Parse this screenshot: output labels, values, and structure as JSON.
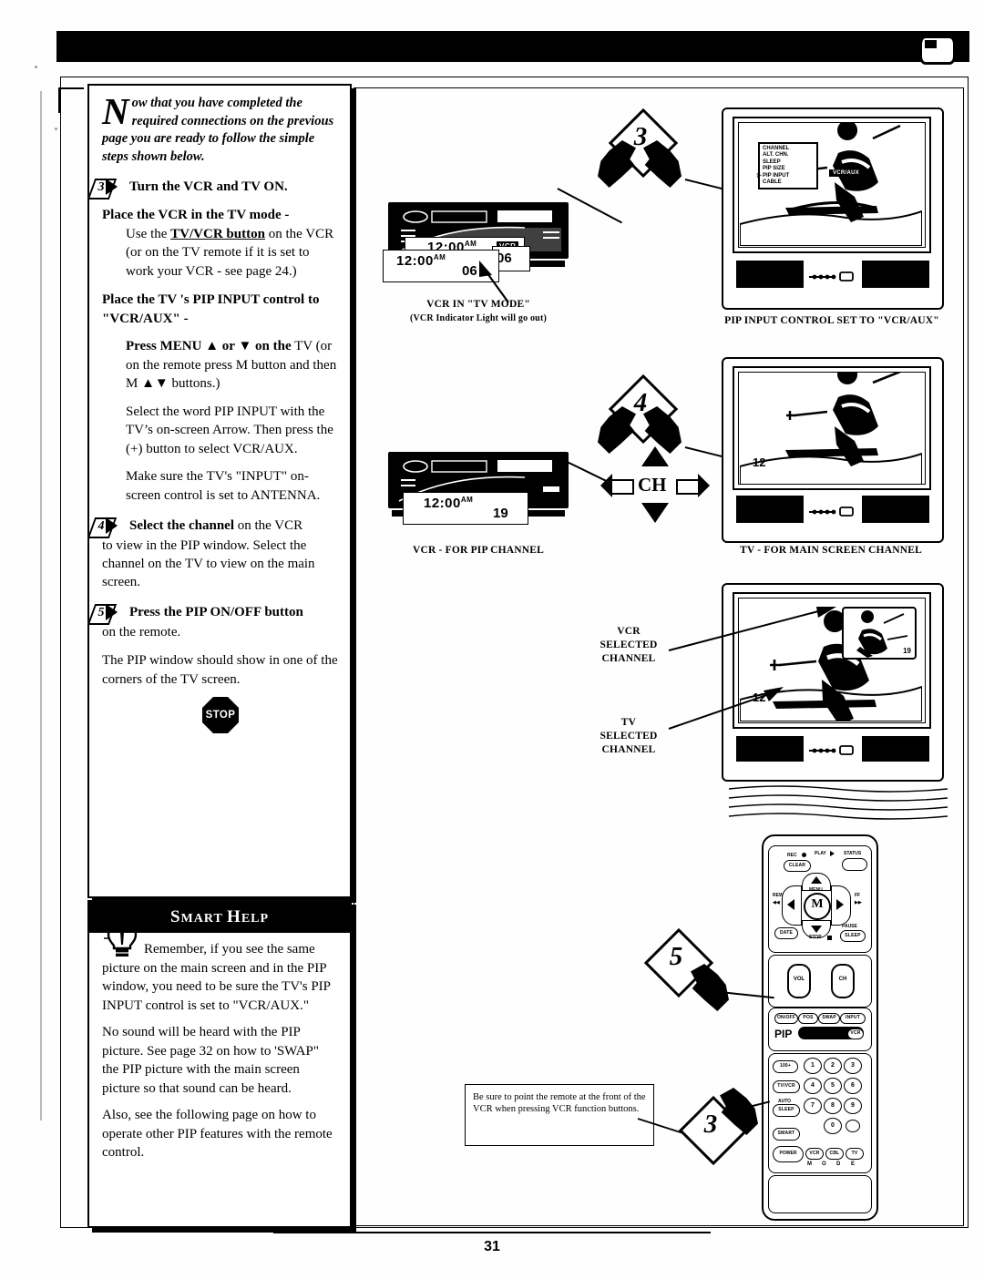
{
  "page": {
    "number": "31",
    "header_icon": "tv-pip-icon"
  },
  "left_column": {
    "intro": {
      "dropcap": "N",
      "text": "ow that you have completed the required connections on the previous page you are ready to follow the simple steps shown below."
    },
    "steps": [
      {
        "number": "3",
        "heading": "Turn the VCR and TV ON.",
        "blocks": [
          {
            "bold": "Place the VCR in the TV mode -",
            "indent": false
          },
          {
            "text_a": "Use the ",
            "underline": "TV/VCR button",
            "text_b": " on the VCR (or on the TV remote if it is set to work your VCR - see page 24.)",
            "indent": true
          },
          {
            "bold": "Place the TV 's PIP INPUT control to \"VCR/AUX\" -",
            "indent": false
          },
          {
            "bold_b": "Press MENU ▲ or ▼ on the",
            "text_b2": " TV (or on the remote press M button and then M ▲▼ buttons.)",
            "indent": true
          },
          {
            "text": "Select the word PIP INPUT with the TV’s on-screen Arrow. Then press the (+) button to select VCR/AUX.",
            "indent": true
          },
          {
            "text": "Make sure the TV's \"INPUT\" on-screen control is set to ANTENNA.",
            "indent": true
          }
        ]
      },
      {
        "number": "4",
        "heading_bold": "Select the channel",
        "heading_rest": " on the VCR",
        "body": "to view in the PIP window. Select the channel on the TV to view on the main screen."
      },
      {
        "number": "5",
        "heading_bold": "Press the PIP ON/OFF button",
        "heading_rest": "",
        "body": "on the remote.",
        "extra": "The PIP window should show in one of the corners of the TV screen."
      }
    ],
    "stop_label": "STOP"
  },
  "smart_help": {
    "title_1": "S",
    "title_2": "MART ",
    "title_3": "H",
    "title_4": "ELP",
    "icon": "lightbulb-icon",
    "paragraphs": [
      "Remember, if you see the same picture on the main screen and in the PIP window, you need to be sure the TV's PIP INPUT control is set to \"VCR/AUX.\"",
      "No sound will be heard with the PIP picture. See page 32 on how to 'SWAP\" the PIP picture with the main screen picture so that sound can be heard.",
      "Also, see the following page on how to operate other PIP features with the remote control."
    ]
  },
  "illustrations": {
    "flag3_top": "3",
    "flag4": "4",
    "flag5": "5",
    "flag3_bottom": "3",
    "vcr_top": {
      "display_time": "12:00",
      "display_ampm": "AM",
      "display_channel": "06",
      "tag": "VCR",
      "caption_line1": "VCR IN \"TV MODE\"",
      "caption_line2": "(VCR Indicator Light will go out)"
    },
    "tv_top": {
      "caption": "PIP INPUT CONTROL SET TO \"VCR/AUX\"",
      "osd_items": [
        "CHANNEL",
        "ALT. CHN.",
        "SLEEP",
        "PIP SIZE",
        "PIP INPUT",
        "CABLE"
      ],
      "osd_selected": "PIP INPUT",
      "osd_value": "VCR/AUX"
    },
    "vcr_mid": {
      "display_time": "12:00",
      "display_ampm": "AM",
      "display_channel": "19",
      "caption": "VCR - FOR PIP CHANNEL"
    },
    "ch_cluster": {
      "label": "CH"
    },
    "tv_mid": {
      "channel": "12",
      "caption": "TV - FOR MAIN SCREEN CHANNEL"
    },
    "tv_pip": {
      "main_channel": "12",
      "pip_channel": "19",
      "callout_vcr": [
        "VCR",
        "SELECTED",
        "CHANNEL"
      ],
      "callout_tv": [
        "TV",
        "SELECTED",
        "CHANNEL"
      ]
    },
    "note_box": "Be sure to point the remote at the front of the VCR when pressing VCR function buttons."
  },
  "remote": {
    "rec": "REC",
    "clear": "CLEAR",
    "play": "PLAY",
    "status": "STATUS",
    "rew": "REW",
    "ff": "FF",
    "menu_button": "M",
    "menu_label": "MENU",
    "date": "DATE",
    "stop": "STOP",
    "pause": "PAUSE",
    "sleep_small": "SLEEP",
    "vol": "VOL",
    "ch": "CH",
    "pip_row": [
      "ON/OFF",
      "POS",
      "SWAP",
      "INPUT"
    ],
    "pip_label": "PIP",
    "pip_vcr": "VCR",
    "hundred": "100+",
    "tvvcr": "TV/VCR",
    "auto_sleep_top": "AUTO",
    "auto_sleep": "SLEEP",
    "smart": "SMART",
    "power": "POWER",
    "keys": [
      "1",
      "2",
      "3",
      "4",
      "5",
      "6",
      "7",
      "8",
      "9",
      "0"
    ],
    "mode_label": [
      "M",
      "O",
      "D",
      "E"
    ],
    "mode_buttons": [
      "VCR",
      "CBL",
      "TV"
    ]
  }
}
